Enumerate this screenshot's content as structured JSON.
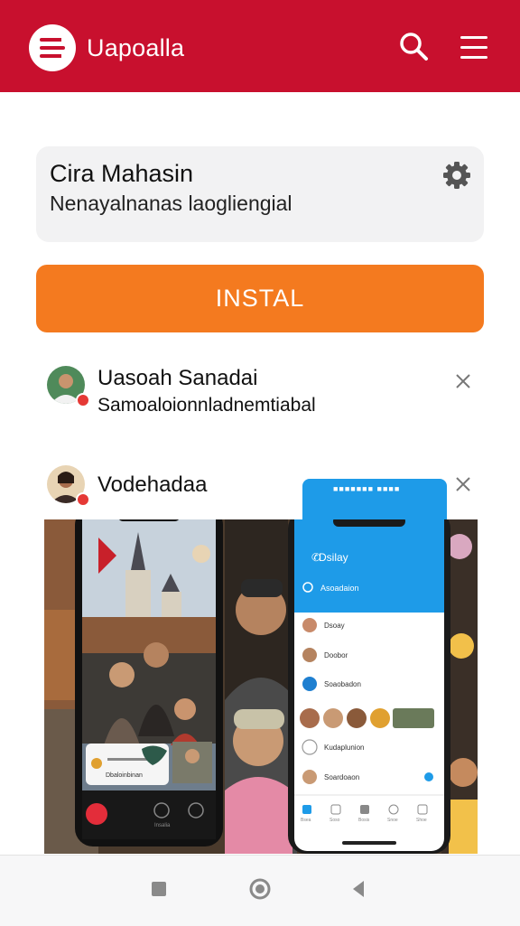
{
  "header": {
    "app_title": "Uapoalla",
    "logo_icon": "menu-lines-icon",
    "search_icon": "search-icon",
    "menu_icon": "hamburger-menu-icon",
    "bar_color": "#c8102e"
  },
  "app_card": {
    "title": "Cira Mahasin",
    "subtitle": "Nenayalnanas laogliengial",
    "settings_icon": "gear-icon"
  },
  "install_button": {
    "label": "INSTAL",
    "color": "#f47a1f"
  },
  "notifications": [
    {
      "title": "Uasoah Sanadai",
      "subtitle": "Samoaloionnladnemtiabal",
      "close_icon": "close-icon"
    },
    {
      "title": "Vodehadaa",
      "subtitle": "",
      "close_icon": "close-icon"
    }
  ],
  "preview": {
    "right_phone": {
      "banner": "■■■■■■■ ■■■■",
      "header_title": "Dsilay",
      "search_text": "Asoadaion",
      "list": [
        "Dsoay",
        "Doobor",
        "Soaobadon",
        "Kudaplunion",
        "Soardoaon"
      ],
      "tabs": [
        "Bsea",
        "Soso",
        "Bosis",
        "Snoe",
        "Shoe"
      ]
    },
    "left_phone": {
      "caption": "Dbaloinbinan",
      "tab_label": "Insalia"
    }
  },
  "system_nav": {
    "recents_icon": "square-icon",
    "home_icon": "circle-home-icon",
    "back_icon": "triangle-back-icon"
  }
}
